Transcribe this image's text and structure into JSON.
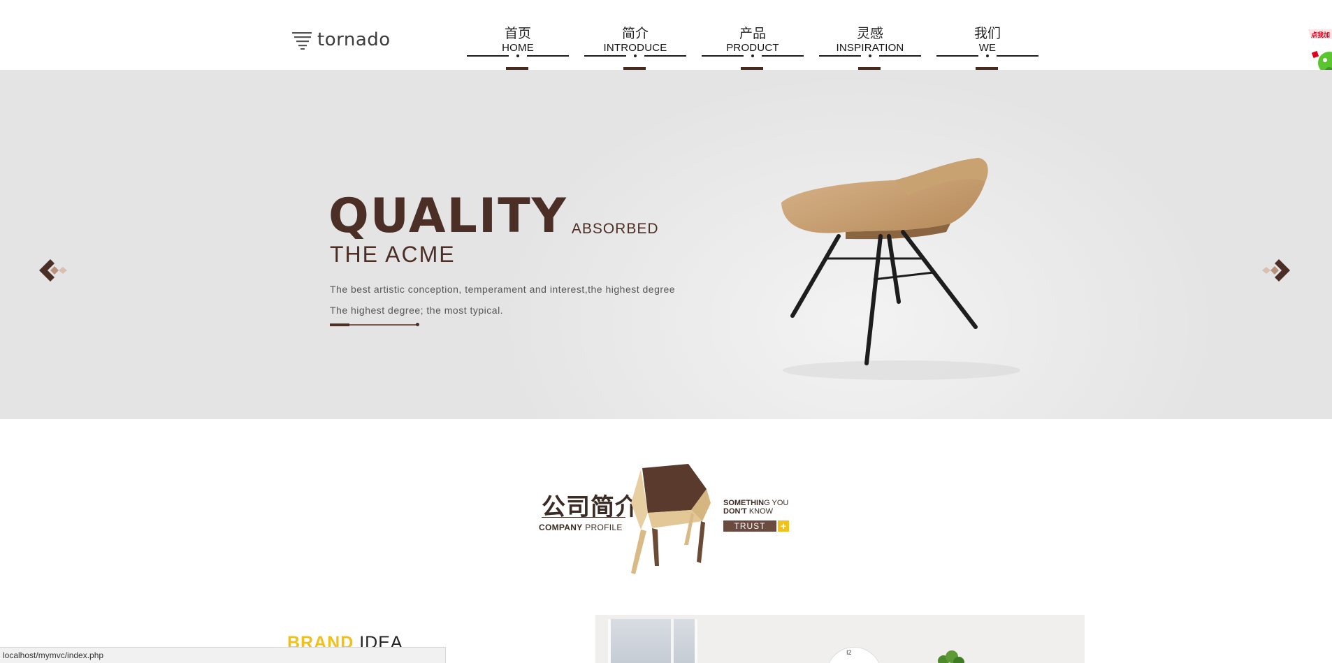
{
  "header": {
    "logo_text": "tornado",
    "nav": [
      {
        "cn": "首页",
        "en": "HOME"
      },
      {
        "cn": "简介",
        "en": "INTRODUCE"
      },
      {
        "cn": "产品",
        "en": "PRODUCT"
      },
      {
        "cn": "灵感",
        "en": "INSPIRATION"
      },
      {
        "cn": "我们",
        "en": "WE"
      }
    ],
    "float_ad_text": "点我加"
  },
  "banner": {
    "title_big": "QUALITY",
    "title_small": "ABSORBED",
    "subtitle": "THE ACME",
    "line1": "The best artistic conception, temperament and interest,the highest degree",
    "line2": "The highest degree; the most typical.",
    "prev_icon": "chevron-left-icon",
    "next_icon": "chevron-right-icon"
  },
  "profile": {
    "cn_title": "公司简介",
    "en_bold": "COMPANY",
    "en_light": "PROFILE",
    "some_bold": "SOMETHIN",
    "some_light": "G YOU",
    "dont_bold": "DON'T",
    "dont_light": "KNOW",
    "trust": "TRUST",
    "plus": "+"
  },
  "brand": {
    "word1": "BRAND",
    "word2": "IDEA"
  },
  "photo": {
    "clock_text": "I2"
  },
  "status": {
    "url": "localhost/mymvc/index.php"
  },
  "colors": {
    "brown": "#4b2f26",
    "accent_yellow": "#f2c01c",
    "banner_bg": "#e4e4e4"
  }
}
